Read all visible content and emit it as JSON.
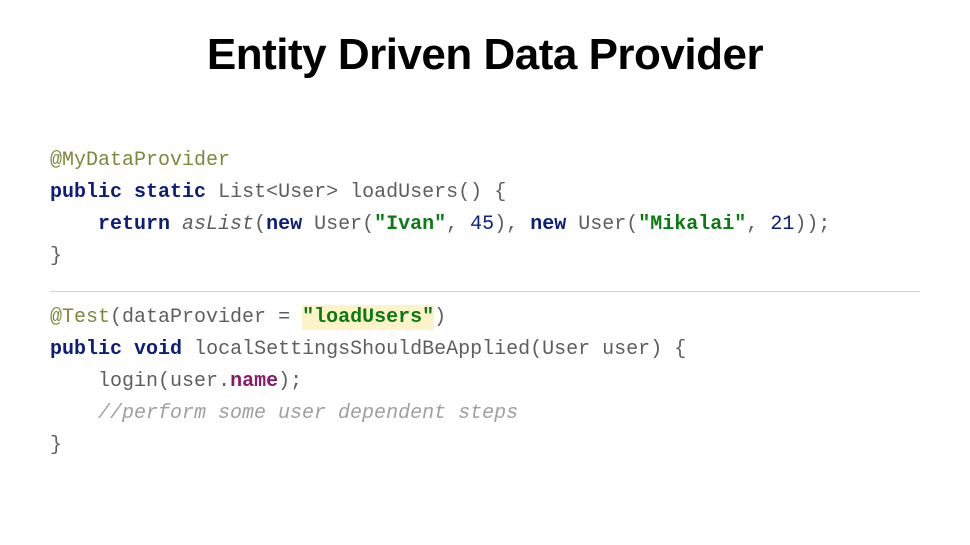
{
  "title": "Entity Driven Data Provider",
  "block1": {
    "annotation": "@MyDataProvider",
    "kw_public": "public",
    "kw_static": "static",
    "type_list": "List",
    "type_user": "User",
    "method_name": "loadUsers",
    "brace_open": "{",
    "kw_return": "return",
    "as_list": "asList",
    "kw_new1": "new",
    "user_ctor1": "User",
    "str_ivan": "\"Ivan\"",
    "num_45": "45",
    "kw_new2": "new",
    "user_ctor2": "User",
    "str_mikalai": "\"Mikalai\"",
    "num_21": "21",
    "brace_close": "}"
  },
  "block2": {
    "annotation": "@Test",
    "attr_name": "dataProvider",
    "eq": " = ",
    "attr_value": "\"loadUsers\"",
    "kw_public": "public",
    "kw_void": "void",
    "method_name": "localSettingsShouldBeApplied",
    "param_type": "User",
    "param_name": "user",
    "brace_open": "{",
    "login_call": "login",
    "user_ref": "user",
    "dot": ".",
    "field_name": "name",
    "comment": "//perform some user dependent steps",
    "brace_close": "}"
  }
}
